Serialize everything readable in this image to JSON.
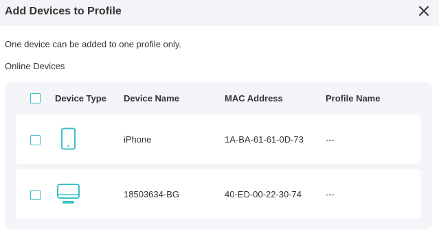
{
  "dialog": {
    "title": "Add Devices to Profile",
    "description": "One device can be added to one profile only.",
    "section_label": "Online Devices"
  },
  "table": {
    "headers": [
      "Device Type",
      "Device Name",
      "MAC Address",
      "Profile Name"
    ],
    "rows": [
      {
        "device_type_icon": "phone-icon",
        "name": "iPhone",
        "mac": "1A-BA-61-61-0D-73",
        "profile": "---",
        "checked": false
      },
      {
        "device_type_icon": "monitor-icon",
        "name": "18503634-BG",
        "mac": "40-ED-00-22-30-74",
        "profile": "---",
        "checked": false
      }
    ]
  },
  "colors": {
    "accent": "#3cbfc9",
    "header_bg": "#f2f4f7",
    "panel_bg": "#f3f5f9",
    "text": "#333333"
  }
}
